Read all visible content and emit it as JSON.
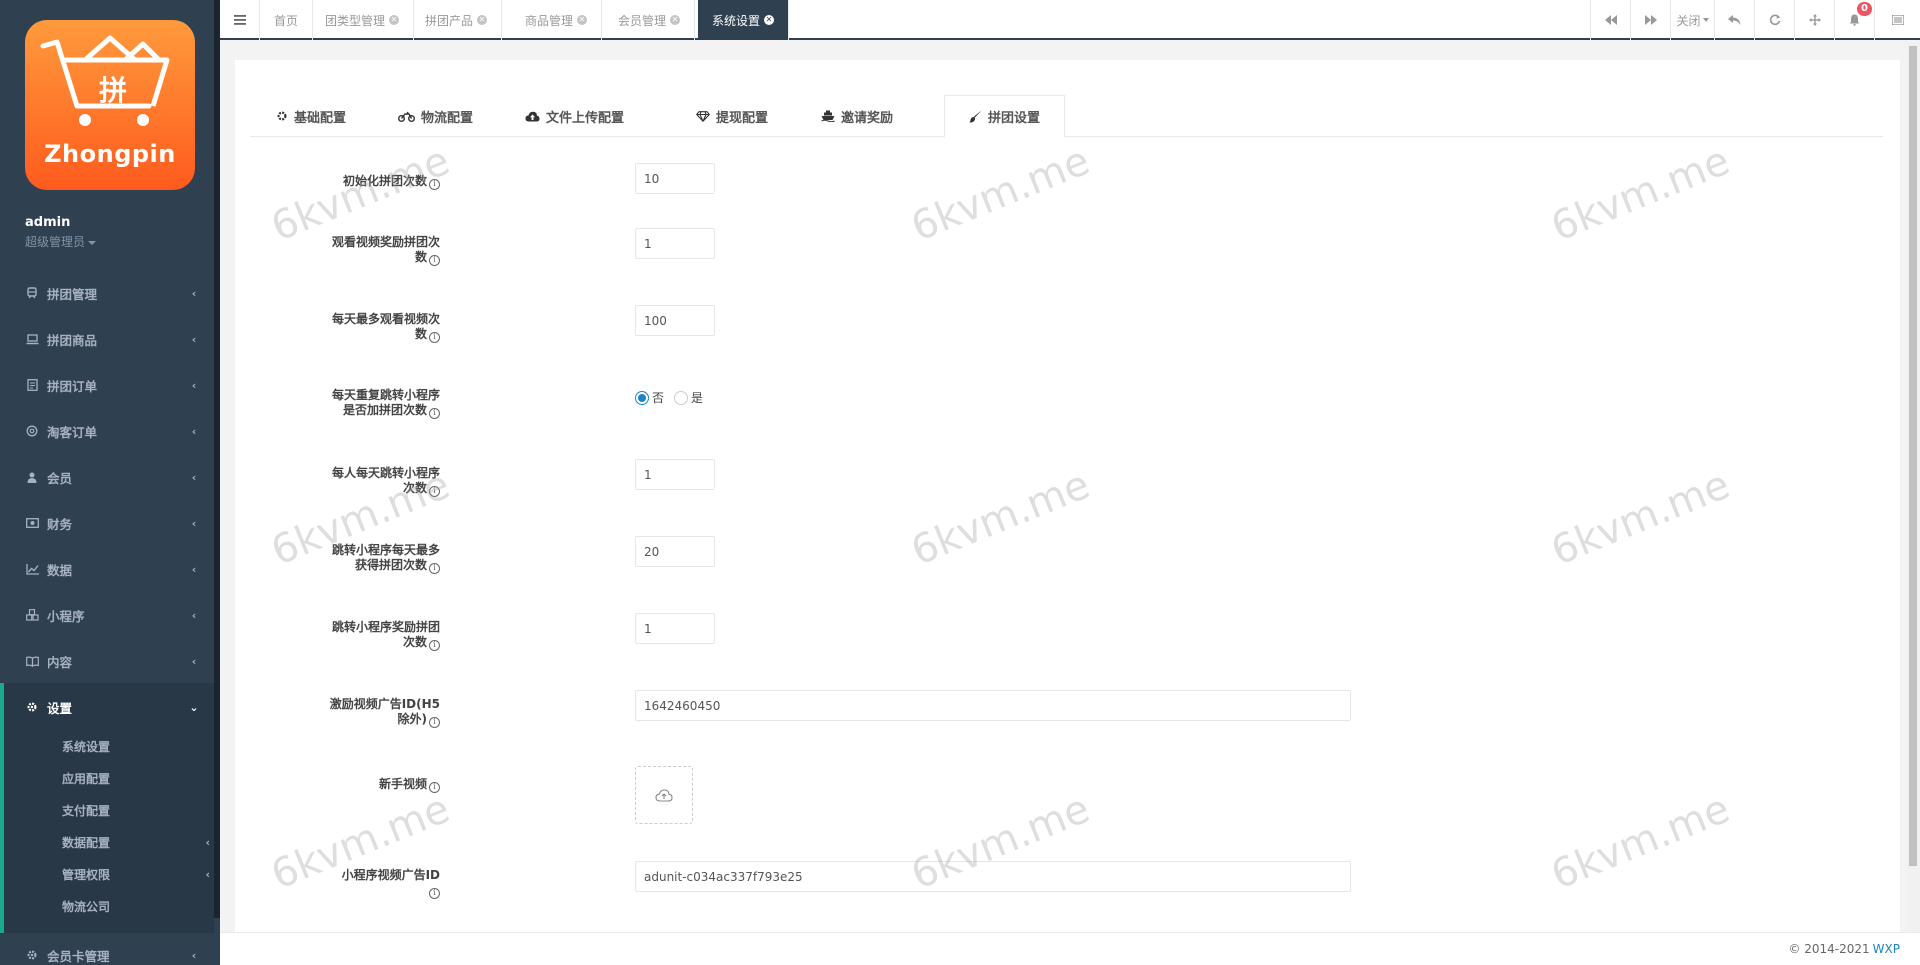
{
  "sidebar": {
    "logo_text": "Zhongpin",
    "logo_glyph": "拼",
    "user_name": "admin",
    "user_role": "超级管理员",
    "items": [
      {
        "label": "拼团管理",
        "icon": "train-icon"
      },
      {
        "label": "拼团商品",
        "icon": "laptop-icon"
      },
      {
        "label": "拼团订单",
        "icon": "document-icon"
      },
      {
        "label": "淘客订单",
        "icon": "crosshair-icon"
      },
      {
        "label": "会员",
        "icon": "user-icon"
      },
      {
        "label": "财务",
        "icon": "money-icon"
      },
      {
        "label": "数据",
        "icon": "line-chart-icon"
      },
      {
        "label": "小程序",
        "icon": "cubes-icon"
      },
      {
        "label": "内容",
        "icon": "book-icon"
      },
      {
        "label": "设置",
        "icon": "gear-icon"
      },
      {
        "label": "会员卡管理",
        "icon": "gear-icon"
      }
    ],
    "submenu": [
      {
        "label": "系统设置",
        "has_children": false
      },
      {
        "label": "应用配置",
        "has_children": false
      },
      {
        "label": "支付配置",
        "has_children": false
      },
      {
        "label": "数据配置",
        "has_children": true
      },
      {
        "label": "管理权限",
        "has_children": true
      },
      {
        "label": "物流公司",
        "has_children": false
      }
    ]
  },
  "topbar": {
    "tabs": [
      "首页",
      "团类型管理",
      "拼团产品",
      "商品管理",
      "会员管理",
      "系统设置"
    ],
    "active_tab": "系统设置",
    "close_label": "关闭",
    "notification_count": "0"
  },
  "config_tabs": [
    {
      "label": "基础配置",
      "icon": "gear-icon"
    },
    {
      "label": "物流配置",
      "icon": "motorcycle-icon"
    },
    {
      "label": "文件上传配置",
      "icon": "cloud-upload-icon"
    },
    {
      "label": "提现配置",
      "icon": "diamond-icon"
    },
    {
      "label": "邀请奖励",
      "icon": "ship-icon"
    },
    {
      "label": "拼团设置",
      "icon": "brush-icon"
    }
  ],
  "active_config_tab": "拼团设置",
  "form": {
    "f1": {
      "label": "初始化拼团次数",
      "value": "10"
    },
    "f2": {
      "label1": "观看视频奖励拼团次",
      "label2": "数",
      "value": "1"
    },
    "f3": {
      "label1": "每天最多观看视频次",
      "label2": "数",
      "value": "100"
    },
    "f4": {
      "label1": "每天重复跳转小程序",
      "label2": "是否加拼团次数",
      "options": [
        "否",
        "是"
      ],
      "selected": "否"
    },
    "f5": {
      "label1": "每人每天跳转小程序",
      "label2": "次数",
      "value": "1"
    },
    "f6": {
      "label1": "跳转小程序每天最多",
      "label2": "获得拼团次数",
      "value": "20"
    },
    "f7": {
      "label1": "跳转小程序奖励拼团",
      "label2": "次数",
      "value": "1"
    },
    "f8": {
      "label1": "激励视频广告ID(H5",
      "label2": "除外)",
      "value": "1642460450"
    },
    "f9": {
      "label": "新手视频"
    },
    "f10": {
      "label1": "小程序视频广告ID",
      "value": "adunit-c034ac337f793e25"
    }
  },
  "watermark": "6kvm.me",
  "footer": {
    "copyright": "© 2014-2021",
    "brand": "WXP"
  },
  "colors": {
    "sidebar": "#2f4050",
    "accent": "#19aa8d",
    "link": "#1c84c6",
    "badge": "#ed5565",
    "logo": "#ff7a2a"
  }
}
